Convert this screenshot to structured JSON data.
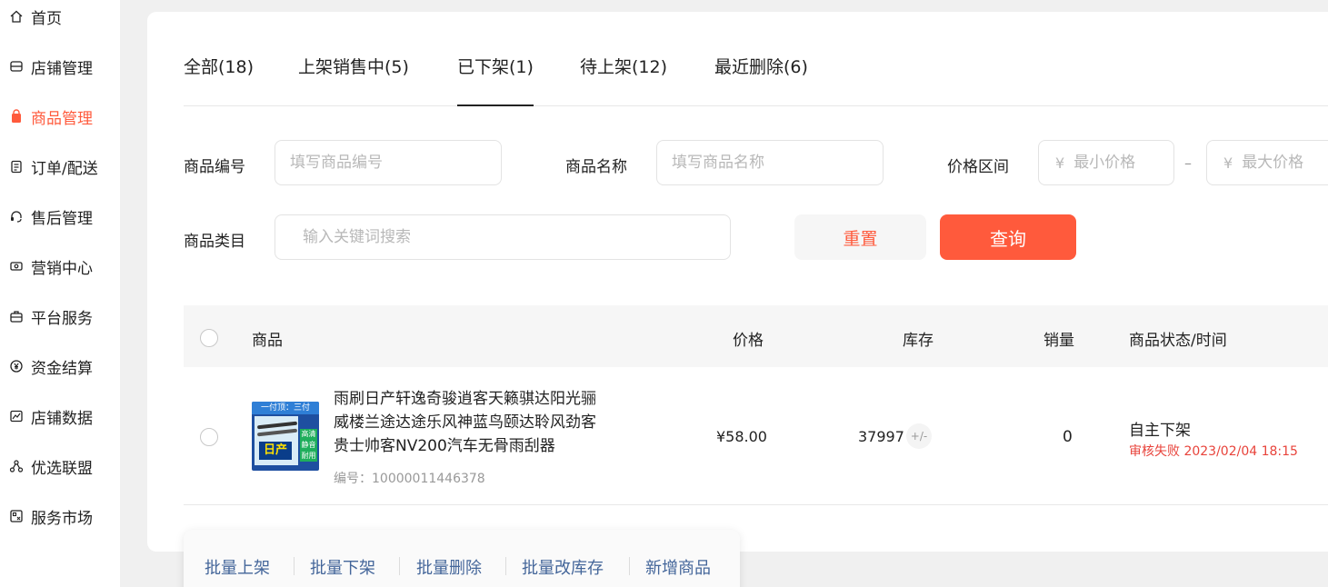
{
  "sidebar": {
    "items": [
      {
        "label": "首页",
        "icon": "home-icon"
      },
      {
        "label": "店铺管理",
        "icon": "store-icon"
      },
      {
        "label": "商品管理",
        "icon": "shopping-bag-icon",
        "active": true
      },
      {
        "label": "订单/配送",
        "icon": "clipboard-icon"
      },
      {
        "label": "售后管理",
        "icon": "headset-icon"
      },
      {
        "label": "营销中心",
        "icon": "ticket-icon"
      },
      {
        "label": "平台服务",
        "icon": "briefcase-icon"
      },
      {
        "label": "资金结算",
        "icon": "yen-coin-icon"
      },
      {
        "label": "店铺数据",
        "icon": "chart-icon"
      },
      {
        "label": "优选联盟",
        "icon": "network-icon"
      },
      {
        "label": "服务市场",
        "icon": "grid-icon"
      }
    ],
    "active_color": "#ff5a3c"
  },
  "tabs": [
    {
      "label": "全部(18)"
    },
    {
      "label": "上架销售中(5)"
    },
    {
      "label": "已下架(1)",
      "active": true
    },
    {
      "label": "待上架(12)"
    },
    {
      "label": "最近删除(6)"
    }
  ],
  "filters": {
    "code_label": "商品编号",
    "code_placeholder": "填写商品编号",
    "name_label": "商品名称",
    "name_placeholder": "填写商品名称",
    "price_label": "价格区间",
    "price_symbol": "¥",
    "min_price_placeholder": "最小价格",
    "max_price_placeholder": "最大价格",
    "price_separator": "–",
    "category_label": "商品类目",
    "category_placeholder": "输入关键词搜索",
    "reset_label": "重置",
    "query_label": "查询"
  },
  "table": {
    "columns": {
      "product": "商品",
      "price": "价格",
      "stock": "库存",
      "sales": "销量",
      "status": "商品状态/时间"
    },
    "rows": [
      {
        "title": "雨刷日产轩逸奇骏逍客天籁骐达阳光骊威楼兰途达途乐风神蓝鸟颐达聆风劲客贵士帅客NV200汽车无骨雨刮器",
        "code": "编号：10000011446378",
        "price": "¥58.00",
        "stock": "37997",
        "stock_edit": "+/-",
        "sales": "0",
        "status": "自主下架",
        "status_sub": "审核失败 2023/02/04 18:15",
        "thumb": {
          "top_text": "一付顶：三付",
          "brand_text": "日产",
          "side_text": "高清静音耐用"
        }
      }
    ]
  },
  "batch_actions": [
    {
      "label": "批量上架"
    },
    {
      "label": "批量下架"
    },
    {
      "label": "批量删除"
    },
    {
      "label": "批量改库存"
    },
    {
      "label": "新增商品"
    }
  ],
  "colors": {
    "primary": "#ff5a3c",
    "error": "#e8433b",
    "batch_link": "#44669a"
  }
}
